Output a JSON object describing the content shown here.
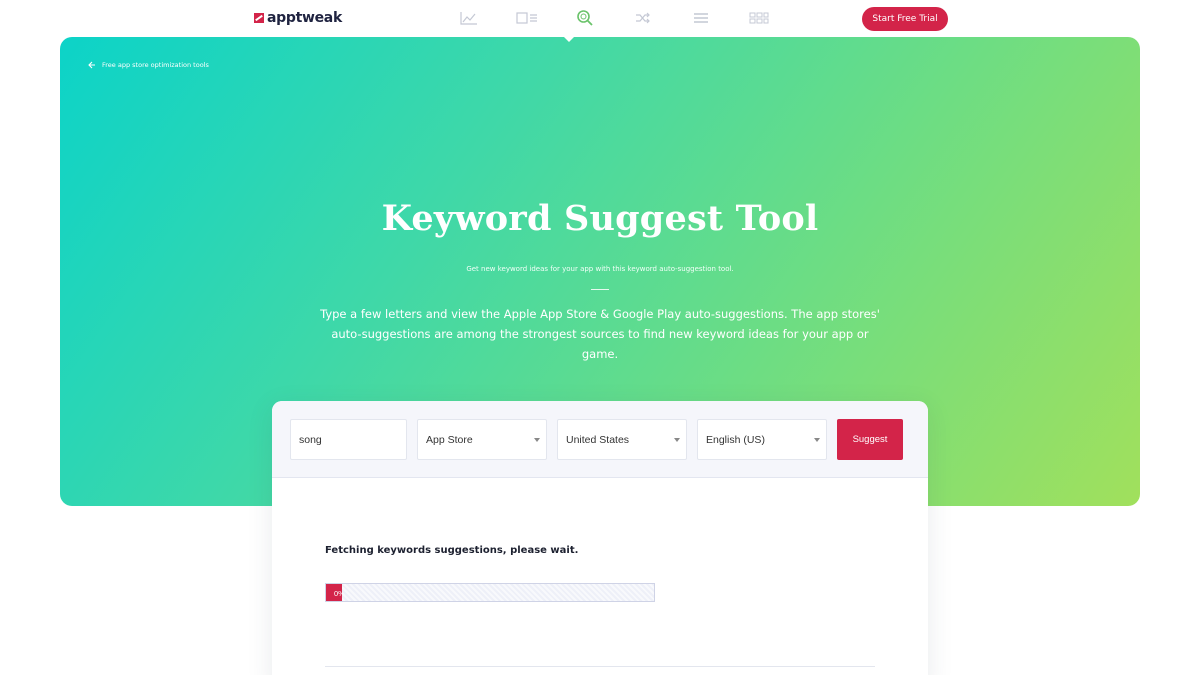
{
  "brand": {
    "name": "apptweak",
    "accent": "#d32449"
  },
  "nav": {
    "icons": [
      "chart-line-icon",
      "page-list-icon",
      "search-icon",
      "shuffle-icon",
      "list-icon",
      "grid-icon"
    ],
    "active_icon": "search-icon",
    "active_color": "#6ac36a",
    "cta_label": "Start Free Trial"
  },
  "hero": {
    "back_link": "Free app store optimization tools",
    "title": "Keyword Suggest Tool",
    "subtitle": "Get new keyword ideas for your app with this keyword auto-suggestion tool.",
    "description": "Type a few letters and view the Apple App Store & Google Play auto-suggestions. The app stores' auto-suggestions are among the strongest sources to find new keyword ideas for your app or game.",
    "gradient_start": "#0cd3c8",
    "gradient_end": "#a1e05c"
  },
  "form": {
    "keyword_value": "song",
    "store_selected": "App Store",
    "country_selected": "United States",
    "language_selected": "English (US)",
    "submit_label": "Suggest"
  },
  "status": {
    "message": "Fetching keywords suggestions, please wait.",
    "progress_percent": 0,
    "progress_label": "0%"
  }
}
